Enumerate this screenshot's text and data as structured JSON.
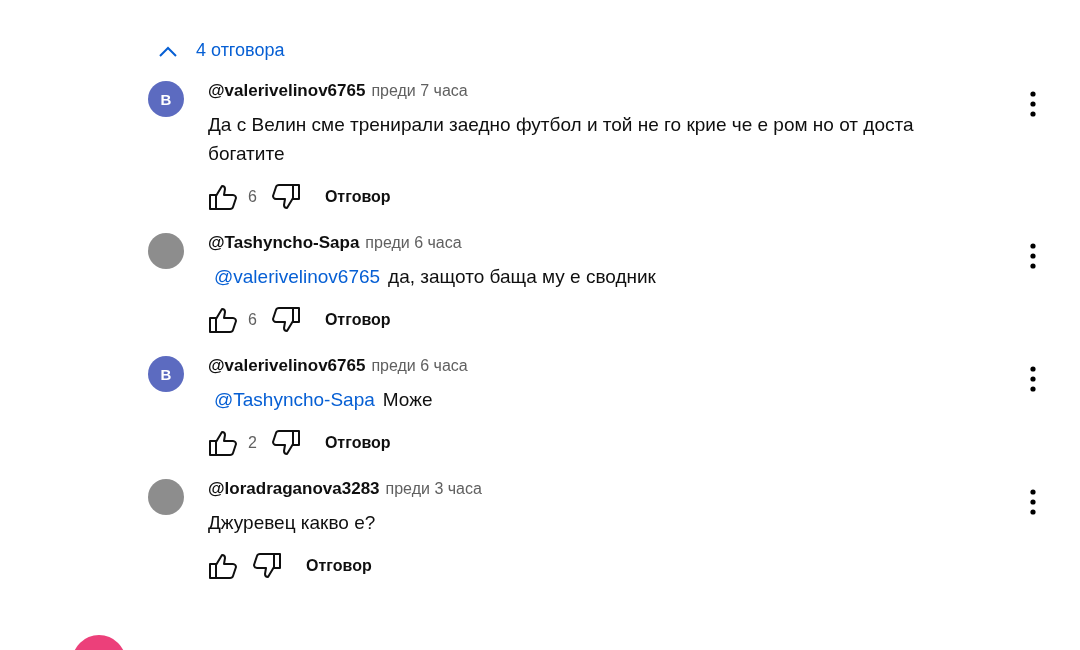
{
  "replies_toggle": {
    "label": "4 отговора",
    "expanded": true
  },
  "replies": [
    {
      "avatar": {
        "kind": "letter",
        "letter": "В",
        "color": "#5c6bc0"
      },
      "author": "@valerivelinov6765",
      "time": "преди 7 часа",
      "text": "Да с Велин сме тренирали заедно футбол и той не го крие че е ром но от доста богатите",
      "likes": "6",
      "reply": "Отговор"
    },
    {
      "avatar": {
        "kind": "photo"
      },
      "author": "@Tashyncho-Sapa",
      "time": "преди 6 часа",
      "mention": "@valerivelinov6765",
      "text": "да, защото баща му е сводник",
      "likes": "6",
      "reply": "Отговор"
    },
    {
      "avatar": {
        "kind": "letter",
        "letter": "В",
        "color": "#5c6bc0"
      },
      "author": "@valerivelinov6765",
      "time": "преди 6 часа",
      "mention": "@Tashyncho-Sapa",
      "text": "Може",
      "likes": "2",
      "reply": "Отговор"
    },
    {
      "avatar": {
        "kind": "photo"
      },
      "author": "@loradraganova3283",
      "time": "преди 3 часа",
      "text": "Джуревец какво е?",
      "reply": "Отговор"
    }
  ],
  "next_comment": {
    "avatar": {
      "kind": "letter",
      "color": "#ec407a"
    }
  }
}
